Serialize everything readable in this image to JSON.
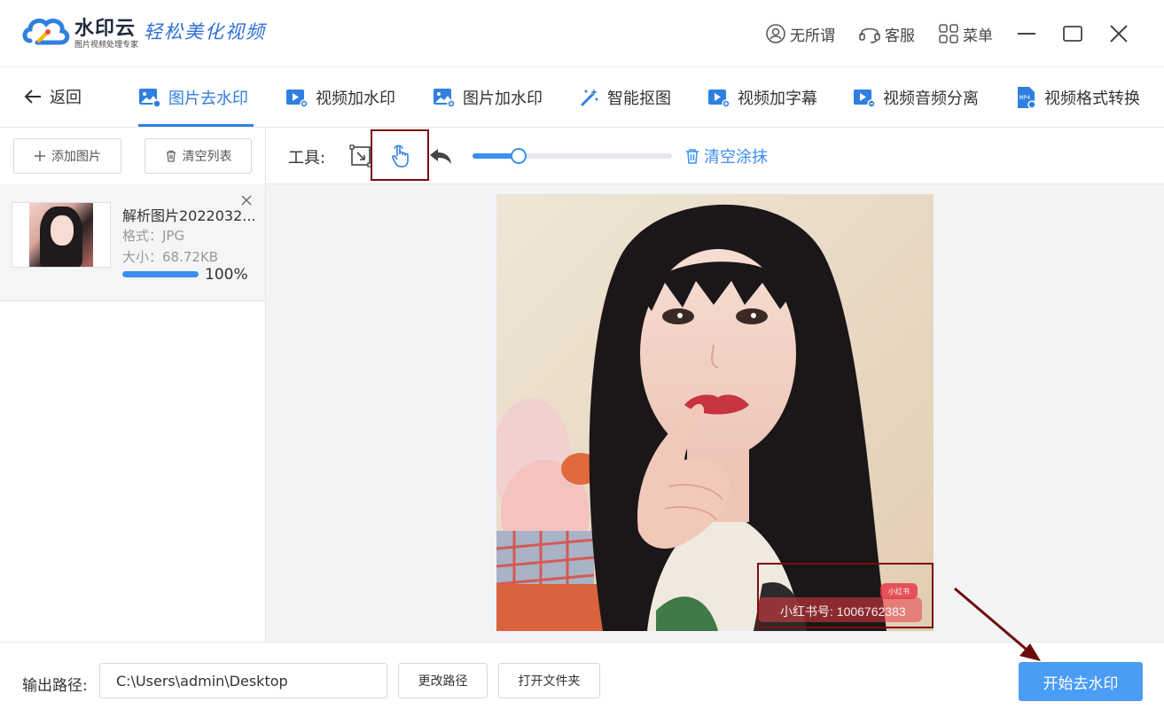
{
  "app": {
    "brand_name": "水印云",
    "brand_sub": "图片视频处理专家",
    "slogan": "轻松美化视频"
  },
  "titlebar": {
    "user_label": "无所谓",
    "service_label": "客服",
    "menu_label": "菜单"
  },
  "nav": {
    "back_label": "返回",
    "tabs": [
      {
        "label": "图片去水印",
        "active": true
      },
      {
        "label": "视频加水印"
      },
      {
        "label": "图片加水印"
      },
      {
        "label": "智能抠图"
      },
      {
        "label": "视频加字幕"
      },
      {
        "label": "视频音频分离"
      },
      {
        "label": "视频格式转换"
      }
    ],
    "mp4_badge": "MP4"
  },
  "left": {
    "add_label": "添加图片",
    "clear_label": "清空列表",
    "files": [
      {
        "name": "解析图片2022032...",
        "format": "格式：JPG",
        "size": "大小：68.72KB",
        "progress": 100,
        "progress_text": "100%"
      }
    ]
  },
  "toolbar": {
    "tools_label": "工具:",
    "brush_level": 0.23,
    "clear_smear_label": "清空涂抹"
  },
  "canvas": {
    "watermark_text": "小红书号: 1006762383",
    "watermark_logo": "小红书"
  },
  "bottom": {
    "output_label": "输出路径:",
    "output_path": "C:\\Users\\admin\\Desktop",
    "change_path_label": "更改路径",
    "open_folder_label": "打开文件夹",
    "start_label": "开始去水印"
  },
  "colors": {
    "accent": "#2f7fe0",
    "primary_button": "#4a9cf5",
    "annotation": "#7a0f0f"
  }
}
